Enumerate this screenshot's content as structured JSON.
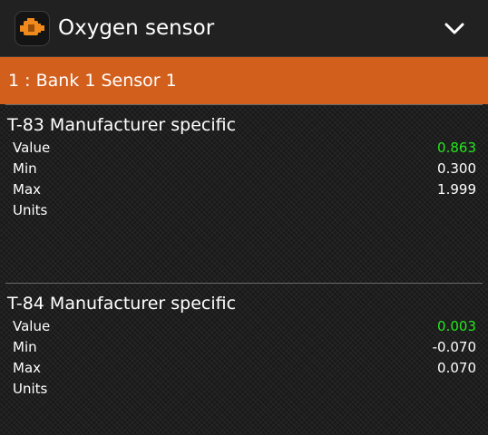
{
  "header": {
    "title": "Oxygen sensor",
    "app_icon": "check-engine-icon",
    "menu_icon": "chevron-down-icon"
  },
  "section": {
    "label": "1 : Bank 1 Sensor 1"
  },
  "colors": {
    "header_bg": "#212121",
    "section_bar": "#d35f1d",
    "live_value": "#25e81d",
    "text": "#ffffff"
  },
  "sensors": [
    {
      "title": "T-83 Manufacturer specific",
      "value_label": "Value",
      "value": "0.863",
      "min_label": "Min",
      "min": "0.300",
      "max_label": "Max",
      "max": "1.999",
      "units_label": "Units",
      "units": ""
    },
    {
      "title": "T-84 Manufacturer specific",
      "value_label": "Value",
      "value": "0.003",
      "min_label": "Min",
      "min": "-0.070",
      "max_label": "Max",
      "max": "0.070",
      "units_label": "Units",
      "units": ""
    }
  ]
}
